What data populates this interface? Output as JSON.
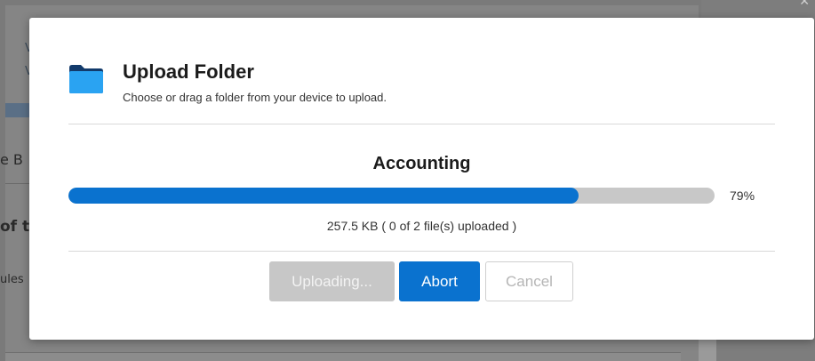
{
  "background": {
    "top_text_lines": [
      "V",
      "V"
    ],
    "row1_text": "e B",
    "row2_text": "of t",
    "row3_text": "ules"
  },
  "dialog": {
    "title": "Upload Folder",
    "subtitle": "Choose or drag a folder from your device to upload.",
    "folder_icon": "folder-icon",
    "folder_name": "Accounting",
    "progress": {
      "percent_value": 79,
      "percent_label": "79%",
      "fill_color": "#0a72cf",
      "track_color": "#c8c8c8"
    },
    "upload_status": "257.5 KB ( 0 of 2 file(s) uploaded )",
    "buttons": {
      "uploading_label": "Uploading...",
      "abort_label": "Abort",
      "cancel_label": "Cancel"
    },
    "accent_color": "#0a72cf"
  }
}
